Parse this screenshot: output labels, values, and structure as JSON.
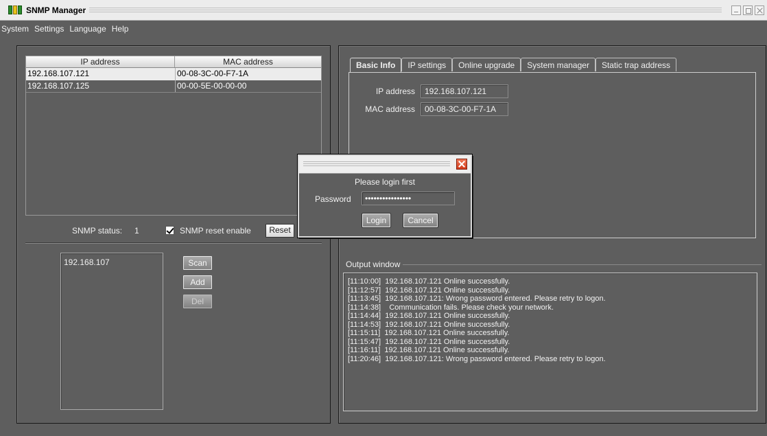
{
  "window": {
    "title": "SNMP Manager"
  },
  "menu": [
    "System",
    "Settings",
    "Language",
    "Help"
  ],
  "device_table": {
    "columns": [
      "IP address",
      "MAC address"
    ],
    "rows": [
      {
        "ip": "192.168.107.121",
        "mac": "00-08-3C-00-F7-1A"
      },
      {
        "ip": "192.168.107.125",
        "mac": "00-00-5E-00-00-00"
      }
    ]
  },
  "snmp": {
    "status_label": "SNMP status:",
    "status_value": "1",
    "reset_enable_label": "SNMP reset enable",
    "reset_enable_checked": true,
    "reset_button": "Reset"
  },
  "scan": {
    "range_value": "192.168.107",
    "scan_button": "Scan",
    "add_button": "Add",
    "del_button": "Del"
  },
  "tabs": [
    "Basic Info",
    "IP settings",
    "Online upgrade",
    "System manager",
    "Static trap address"
  ],
  "basic_info": {
    "ip_label": "IP address",
    "ip_value": "192.168.107.121",
    "mac_label": "MAC address",
    "mac_value": "00-08-3C-00-F7-1A"
  },
  "output": {
    "label": "Output window",
    "lines": [
      "[11:10:00]  192.168.107.121 Online successfully.",
      "[11:12:57]  192.168.107.121 Online successfully.",
      "[11:13:45]  192.168.107.121: Wrong password entered. Please retry to logon.",
      "[11:14:38]    Communication fails. Please check your network.",
      "[11:14:44]  192.168.107.121 Online successfully.",
      "[11:14:53]  192.168.107.121 Online successfully.",
      "[11:15:11]  192.168.107.121 Online successfully.",
      "[11:15:47]  192.168.107.121 Online successfully.",
      "[11:16:11]  192.168.107.121 Online successfully.",
      "[11:20:46]  192.168.107.121: Wrong password entered. Please retry to logon."
    ]
  },
  "login_dialog": {
    "message": "Please login first",
    "password_label": "Password",
    "password_value": "••••••••••••••••",
    "login_button": "Login",
    "cancel_button": "Cancel"
  }
}
